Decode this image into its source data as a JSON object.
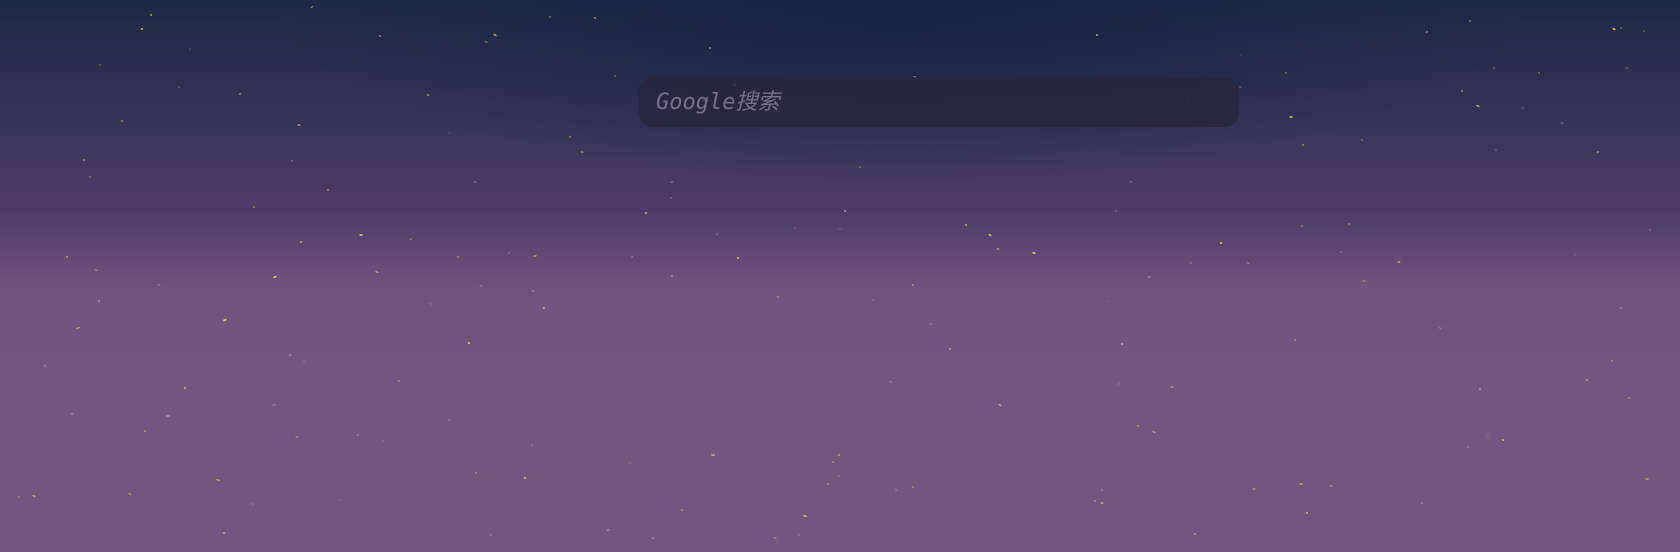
{
  "page": {
    "background": {
      "top_color": "#1d2944",
      "middle_color": "#4b3d68",
      "bottom_color": "#75537e",
      "particle_color": "#f4dfb2"
    }
  },
  "search": {
    "placeholder": "Google搜索",
    "value": ""
  }
}
